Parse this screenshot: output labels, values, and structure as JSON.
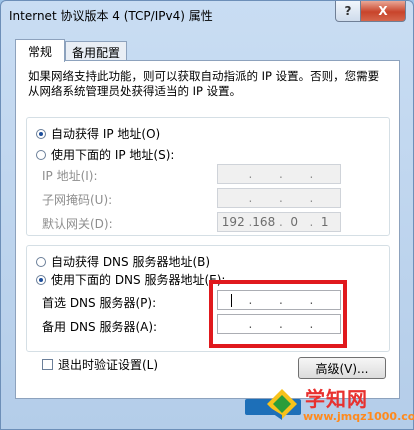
{
  "window": {
    "title": "Internet 协议版本 4 (TCP/IPv4) 属性",
    "help_label": "?",
    "close_label": "X"
  },
  "tabs": [
    {
      "label": "常规",
      "active": true
    },
    {
      "label": "备用配置",
      "active": false
    }
  ],
  "description": "如果网络支持此功能，则可以获取自动指派的 IP 设置。否则，您需要从网络系统管理员处获得适当的 IP 设置。",
  "ip_section": {
    "auto_label": "自动获得 IP 地址(O)",
    "manual_label": "使用下面的 IP 地址(S):",
    "selected": "auto",
    "fields": [
      {
        "label": "IP 地址(I):",
        "octets": [
          "",
          "",
          "",
          ""
        ]
      },
      {
        "label": "子网掩码(U):",
        "octets": [
          "",
          "",
          "",
          ""
        ]
      },
      {
        "label": "默认网关(D):",
        "octets": [
          "192",
          "168",
          "0",
          "1"
        ]
      }
    ]
  },
  "dns_section": {
    "auto_label": "自动获得 DNS 服务器地址(B)",
    "manual_label": "使用下面的 DNS 服务器地址(E):",
    "selected": "manual",
    "fields": [
      {
        "label": "首选 DNS 服务器(P):",
        "octets": [
          "",
          "",
          "",
          ""
        ]
      },
      {
        "label": "备用 DNS 服务器(A):",
        "octets": [
          "",
          "",
          "",
          ""
        ]
      }
    ]
  },
  "validate_checkbox": {
    "label": "退出时验证设置(L)",
    "checked": false
  },
  "advanced_button": "高级(V)...",
  "watermark": {
    "name": "学知网",
    "url": "www.jmqz1000.com"
  },
  "colors": {
    "highlight": "#e0191d",
    "watermark_red": "#e8312f",
    "watermark_orange": "#ff8a1d"
  }
}
